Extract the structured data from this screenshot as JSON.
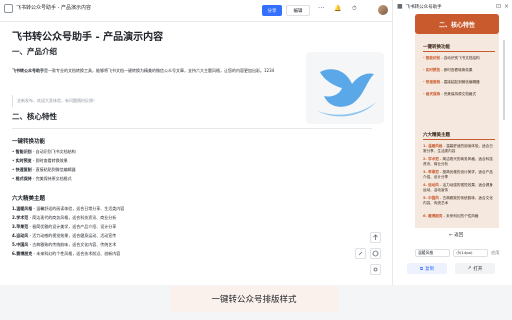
{
  "window": {
    "title": "飞书转公众号助手 - 产品演示内容",
    "share_label": "分享",
    "edit_label": "编辑",
    "more": "···"
  },
  "doc": {
    "title": "飞书转公众号助手 - 产品演示内容",
    "section1": "一、产品介绍",
    "intro_bold": "飞书转公众号助手",
    "intro_text": "是一款专业的文档转换工具，能够将飞书文档一键转换为精美的微信公众号文章，支持六大主题风格，让您的内容更加出彩。1234",
    "quote": "全新发布，欢迎大家体验，有问题随时反馈！",
    "section2": "二、核心特性",
    "sub1": "一键转换功能",
    "features": [
      {
        "key": "智能识别",
        "text": " - 自动识别飞书文档结构"
      },
      {
        "key": "实时预览",
        "text": " - 即时查看转换效果"
      },
      {
        "key": "快速复制",
        "text": " - 直接粘贴到微信编辑器"
      },
      {
        "key": "格式保持",
        "text": " - 完美保持原文档格式"
      }
    ],
    "sub2": "六大精美主题",
    "themes": [
      {
        "key": "1.温暖风格",
        "text": " - 温馨舒适的阅读体验，适合日常分享、生活类内容"
      },
      {
        "key": "2.学术范",
        "text": " - 简洁现代的商务风格，适合科技资讯、商业分析"
      },
      {
        "key": "3.苹果范",
        "text": " - 极简优雅的设计美学，适合产品介绍、设计分享"
      },
      {
        "key": "4.运动风",
        "text": " - 活力动感的视觉效果，适合健身运动、活动宣传"
      },
      {
        "key": "5.中国风",
        "text": " - 古典雅致的传统韵味，适合文化内容、传统艺术"
      },
      {
        "key": "6.赛博朋克",
        "text": " - 未来科幻的个性风格，适合技术前沿、创新内容"
      }
    ]
  },
  "panel": {
    "title": "飞书转公众号助手",
    "banner": "二、核心特性",
    "h1": "一键转换功能",
    "items1": [
      {
        "k": "- 智能识别",
        "t": " - 自动识别飞书文档结构"
      },
      {
        "k": "- 实时预览",
        "t": " - 即时查看转换效果"
      },
      {
        "k": "- 快速复制",
        "t": " - 直接粘贴到微信编辑器"
      },
      {
        "k": "- 格式保持",
        "t": " - 完美保持原文档格式"
      }
    ],
    "h2": "六大精美主题",
    "items2": [
      {
        "k": "1. 温暖风格",
        "t": " - 温馨舒适的阅读体验，适合日常分享、生活类内容"
      },
      {
        "k": "2. 学术范",
        "t": " - 简洁现代的商务风格，适合科技资讯、商业分析"
      },
      {
        "k": "3. 苹果范",
        "t": " - 极简优雅的设计美学，适合产品介绍、设计分享"
      },
      {
        "k": "4. 运动风",
        "t": " - 活力动感的视觉效果，适合健身运动、活动宣传"
      },
      {
        "k": "5. 中国风",
        "t": " - 古典雅致的传统韵味，适合文化内容、传统艺术"
      },
      {
        "k": "6. 赛博朋克",
        "t": " - 未来科幻的个性风格"
      }
    ],
    "back_label": "返回",
    "theme_label": "温暖风格",
    "size_label": "小(14px)",
    "apply_label": "应用",
    "copy_label": "复制",
    "open_label": "打开"
  },
  "caption": "一键转公众号排版样式",
  "colors": {
    "accent": "#c85a2d",
    "primary": "#3370ff"
  }
}
